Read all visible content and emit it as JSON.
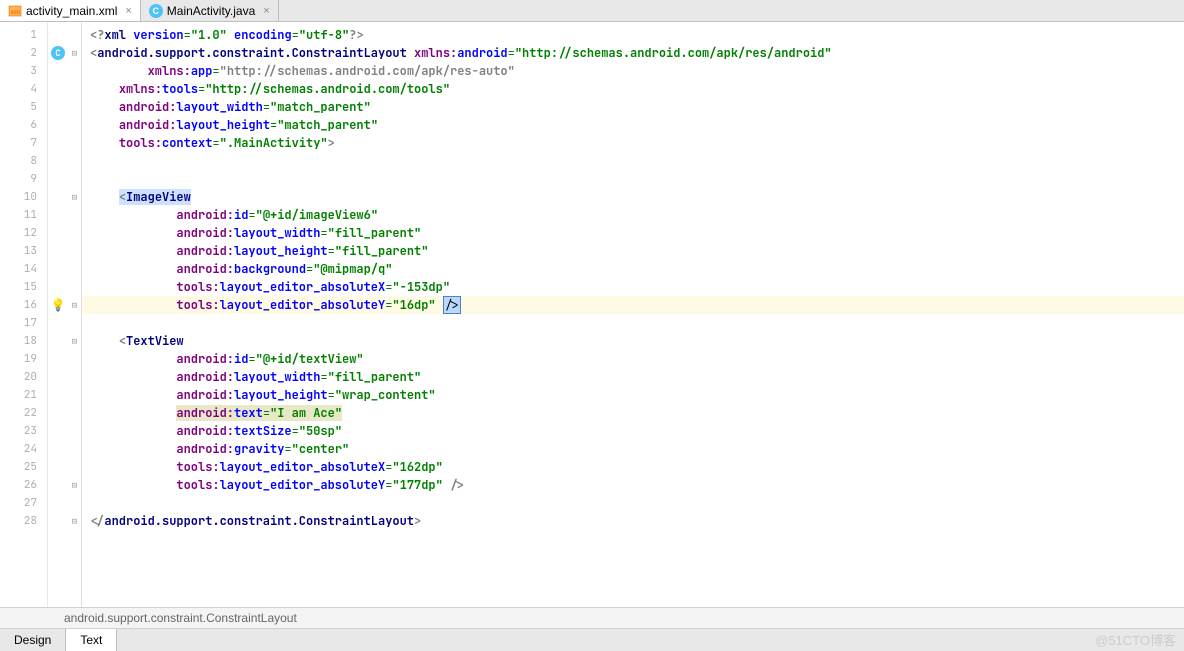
{
  "tabs": [
    {
      "name": "activity_main.xml",
      "icon": "xml-file-icon",
      "active": true
    },
    {
      "name": "MainActivity.java",
      "icon": "java-class-icon",
      "active": false
    }
  ],
  "breadcrumb": "android.support.constraint.ConstraintLayout",
  "bottom_tabs": {
    "design": "Design",
    "text": "Text"
  },
  "watermark": "@51CTO博客",
  "lines": [
    {
      "n": 1,
      "ic": "",
      "fold": "",
      "ind": 0,
      "seg": [
        [
          "pl",
          "<?"
        ],
        [
          "kw",
          "xml"
        ],
        [
          "pl",
          " "
        ],
        [
          "attr",
          "version"
        ],
        [
          "eq",
          "="
        ],
        [
          "str",
          "\"1.0\""
        ],
        [
          "pl",
          " "
        ],
        [
          "attr",
          "encoding"
        ],
        [
          "eq",
          "="
        ],
        [
          "str",
          "\"utf-8\""
        ],
        [
          "pl",
          "?>"
        ]
      ]
    },
    {
      "n": 2,
      "ic": "class",
      "fold": "⊟",
      "ind": 0,
      "seg": [
        [
          "pl",
          "<"
        ],
        [
          "tag",
          "android.support.constraint.ConstraintLayout"
        ],
        [
          "pl",
          " "
        ],
        [
          "ns",
          "xmlns:"
        ],
        [
          "attr",
          "android"
        ],
        [
          "eq",
          "="
        ],
        [
          "str",
          "\"http://schemas.android.com/apk/res/android\""
        ]
      ]
    },
    {
      "n": 3,
      "ic": "",
      "fold": "",
      "ind": 2,
      "seg": [
        [
          "ns",
          "xmlns:"
        ],
        [
          "attr",
          "app"
        ],
        [
          "eq",
          "="
        ],
        [
          "pl",
          "\"http://schemas.android.com/apk/res-auto\""
        ]
      ]
    },
    {
      "n": 4,
      "ic": "",
      "fold": "",
      "ind": 1,
      "seg": [
        [
          "ns",
          "xmlns:"
        ],
        [
          "attr",
          "tools"
        ],
        [
          "eq",
          "="
        ],
        [
          "str",
          "\"http://schemas.android.com/tools\""
        ]
      ]
    },
    {
      "n": 5,
      "ic": "",
      "fold": "",
      "ind": 1,
      "seg": [
        [
          "ns",
          "android:"
        ],
        [
          "attr",
          "layout_width"
        ],
        [
          "eq",
          "="
        ],
        [
          "str",
          "\"match_parent\""
        ]
      ]
    },
    {
      "n": 6,
      "ic": "",
      "fold": "",
      "ind": 1,
      "seg": [
        [
          "ns",
          "android:"
        ],
        [
          "attr",
          "layout_height"
        ],
        [
          "eq",
          "="
        ],
        [
          "str",
          "\"match_parent\""
        ]
      ]
    },
    {
      "n": 7,
      "ic": "",
      "fold": "",
      "ind": 1,
      "seg": [
        [
          "ns",
          "tools:"
        ],
        [
          "attr",
          "context"
        ],
        [
          "eq",
          "="
        ],
        [
          "str",
          "\".MainActivity\""
        ],
        [
          "pl",
          ">"
        ]
      ]
    },
    {
      "n": 8,
      "ic": "",
      "fold": "",
      "ind": 0,
      "seg": []
    },
    {
      "n": 9,
      "ic": "",
      "fold": "",
      "ind": 0,
      "seg": []
    },
    {
      "n": 10,
      "ic": "",
      "fold": "⊟",
      "ind": 1,
      "seg": [
        [
          "sel",
          "<"
        ],
        [
          "seltag",
          "ImageView"
        ]
      ]
    },
    {
      "n": 11,
      "ic": "",
      "fold": "",
      "ind": 3,
      "seg": [
        [
          "ns",
          "android:"
        ],
        [
          "attr",
          "id"
        ],
        [
          "eq",
          "="
        ],
        [
          "str",
          "\"@+id/imageView6\""
        ]
      ]
    },
    {
      "n": 12,
      "ic": "",
      "fold": "",
      "ind": 3,
      "seg": [
        [
          "ns",
          "android:"
        ],
        [
          "attr",
          "layout_width"
        ],
        [
          "eq",
          "="
        ],
        [
          "str",
          "\"fill_parent\""
        ]
      ]
    },
    {
      "n": 13,
      "ic": "",
      "fold": "",
      "ind": 3,
      "seg": [
        [
          "ns",
          "android:"
        ],
        [
          "attr",
          "layout_height"
        ],
        [
          "eq",
          "="
        ],
        [
          "str",
          "\"fill_parent\""
        ]
      ]
    },
    {
      "n": 14,
      "ic": "",
      "fold": "",
      "ind": 3,
      "seg": [
        [
          "ns",
          "android:"
        ],
        [
          "attr",
          "background"
        ],
        [
          "eq",
          "="
        ],
        [
          "str",
          "\"@mipmap/q\""
        ]
      ]
    },
    {
      "n": 15,
      "ic": "",
      "fold": "",
      "ind": 3,
      "seg": [
        [
          "ns",
          "tools:"
        ],
        [
          "attr",
          "layout_editor_absoluteX"
        ],
        [
          "eq",
          "="
        ],
        [
          "str",
          "\"-153dp\""
        ]
      ]
    },
    {
      "n": 16,
      "ic": "bulb",
      "fold": "⊟",
      "ind": 3,
      "hl": true,
      "seg": [
        [
          "ns",
          "tools:"
        ],
        [
          "attr",
          "layout_editor_absoluteY"
        ],
        [
          "eq",
          "="
        ],
        [
          "str",
          "\"16dp\""
        ],
        [
          "pl",
          " "
        ],
        [
          "cursor",
          "/>"
        ]
      ]
    },
    {
      "n": 17,
      "ic": "",
      "fold": "",
      "ind": 0,
      "seg": []
    },
    {
      "n": 18,
      "ic": "",
      "fold": "⊟",
      "ind": 1,
      "seg": [
        [
          "pl",
          "<"
        ],
        [
          "tag",
          "TextView"
        ]
      ]
    },
    {
      "n": 19,
      "ic": "",
      "fold": "",
      "ind": 3,
      "seg": [
        [
          "ns",
          "android:"
        ],
        [
          "attr",
          "id"
        ],
        [
          "eq",
          "="
        ],
        [
          "str",
          "\"@+id/textView\""
        ]
      ]
    },
    {
      "n": 20,
      "ic": "",
      "fold": "",
      "ind": 3,
      "seg": [
        [
          "ns",
          "android:"
        ],
        [
          "attr",
          "layout_width"
        ],
        [
          "eq",
          "="
        ],
        [
          "str",
          "\"fill_parent\""
        ]
      ]
    },
    {
      "n": 21,
      "ic": "",
      "fold": "",
      "ind": 3,
      "seg": [
        [
          "ns",
          "android:"
        ],
        [
          "attr",
          "layout_height"
        ],
        [
          "eq",
          "="
        ],
        [
          "str",
          "\"wrap_content\""
        ]
      ]
    },
    {
      "n": 22,
      "ic": "",
      "fold": "",
      "ind": 3,
      "seg": [
        [
          "err",
          "android:"
        ],
        [
          "errattr",
          "text"
        ],
        [
          "erreq",
          "="
        ],
        [
          "errstr",
          "\"I am Ace\""
        ]
      ]
    },
    {
      "n": 23,
      "ic": "",
      "fold": "",
      "ind": 3,
      "seg": [
        [
          "ns",
          "android:"
        ],
        [
          "attr",
          "textSize"
        ],
        [
          "eq",
          "="
        ],
        [
          "str",
          "\"50sp\""
        ]
      ]
    },
    {
      "n": 24,
      "ic": "",
      "fold": "",
      "ind": 3,
      "seg": [
        [
          "ns",
          "android:"
        ],
        [
          "attr",
          "gravity"
        ],
        [
          "eq",
          "="
        ],
        [
          "str",
          "\"center\""
        ]
      ]
    },
    {
      "n": 25,
      "ic": "",
      "fold": "",
      "ind": 3,
      "seg": [
        [
          "ns",
          "tools:"
        ],
        [
          "attr",
          "layout_editor_absoluteX"
        ],
        [
          "eq",
          "="
        ],
        [
          "str",
          "\"162dp\""
        ]
      ]
    },
    {
      "n": 26,
      "ic": "",
      "fold": "⊟",
      "ind": 3,
      "seg": [
        [
          "ns",
          "tools:"
        ],
        [
          "attr",
          "layout_editor_absoluteY"
        ],
        [
          "eq",
          "="
        ],
        [
          "str",
          "\"177dp\""
        ],
        [
          "pl",
          " />"
        ]
      ]
    },
    {
      "n": 27,
      "ic": "",
      "fold": "",
      "ind": 0,
      "seg": []
    },
    {
      "n": 28,
      "ic": "",
      "fold": "⊟",
      "ind": 0,
      "seg": [
        [
          "pl",
          "</"
        ],
        [
          "tag",
          "android.support.constraint.ConstraintLayout"
        ],
        [
          "pl",
          ">"
        ]
      ]
    }
  ]
}
